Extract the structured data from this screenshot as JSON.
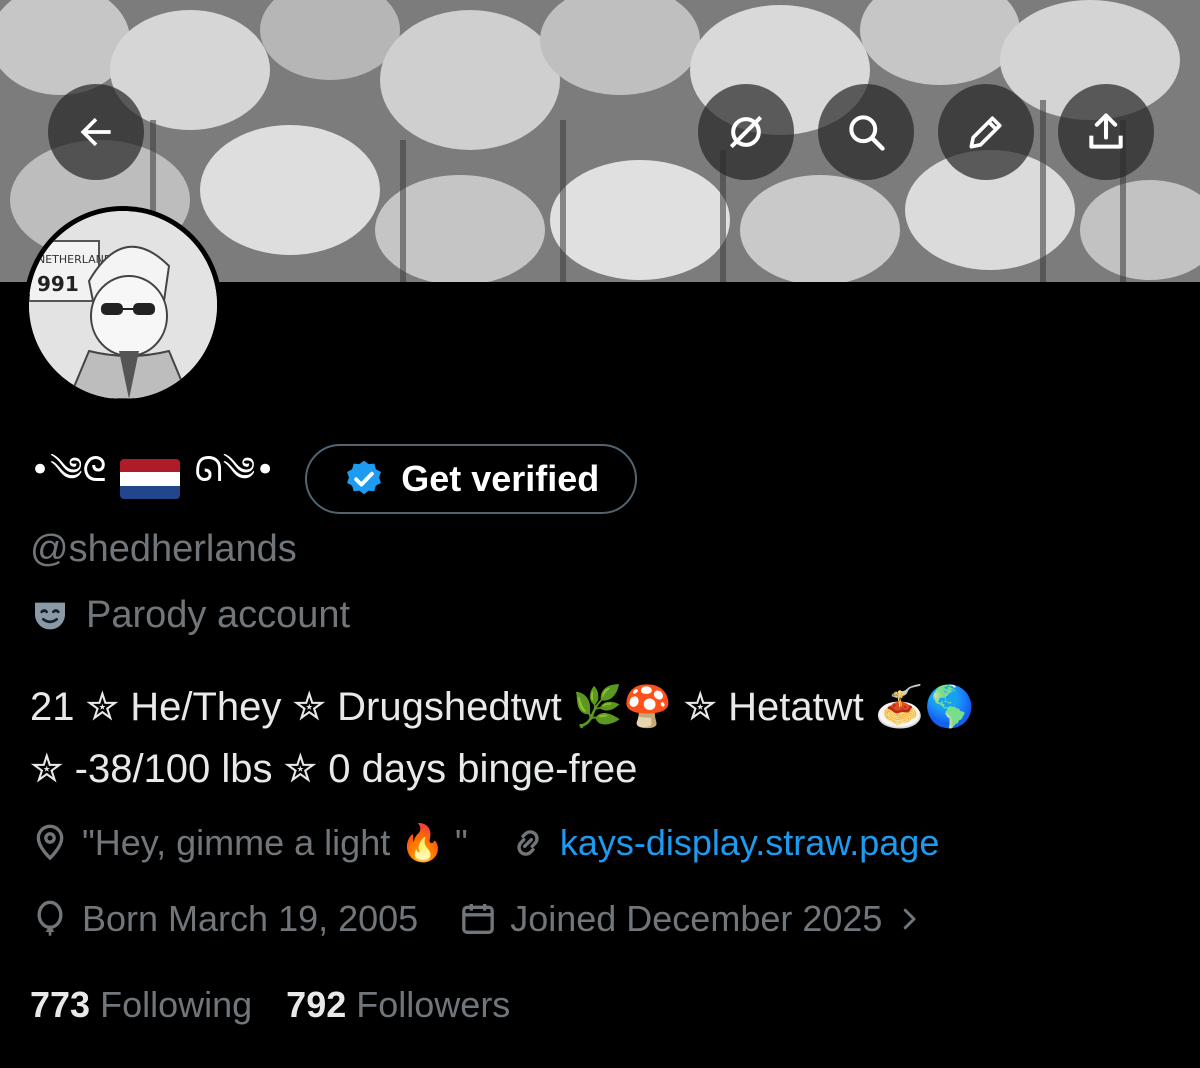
{
  "header": {
    "back_icon": "arrow-left-icon",
    "actions": [
      "grok-icon",
      "search-icon",
      "edit-icon",
      "share-icon"
    ]
  },
  "profile": {
    "display_name_left": "•༄ᘓ",
    "display_name_right": "ᘏ༄•",
    "verify_button_label": "Get verified",
    "handle": "@shedherlands",
    "parody_label": "Parody account",
    "bio_line1": "21 ✮ He/They ✮ Drugshedtwt 🌿🍄 ✮ Hetatwt 🍝🌎",
    "bio_line2": "✮ -38/100 lbs ✮ 0 days binge-free",
    "location": "\"Hey, gimme a light 🔥 \"",
    "website": "kays-display.straw.page",
    "born": "Born March 19, 2005",
    "joined": "Joined December 2025",
    "following_count": "773",
    "following_label": "Following",
    "followers_count": "792",
    "followers_label": "Followers"
  },
  "colors": {
    "background": "#000000",
    "text_primary": "#e7e9ea",
    "text_secondary": "#71767b",
    "accent": "#1d9bf0"
  }
}
